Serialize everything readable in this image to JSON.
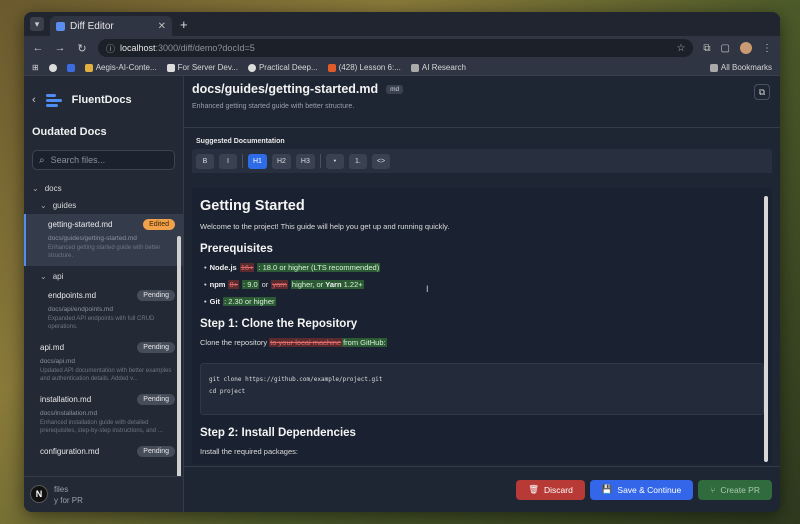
{
  "browser": {
    "tab_title": "Diff Editor",
    "url_host": "localhost",
    "url_path": ":3000/diff/demo?docId=5",
    "bookmarks": [
      "Aegis-AI-Conte...",
      "For Server Dev...",
      "Practical Deep...",
      "(428) Lesson 6:...",
      "AI Research"
    ],
    "all_bookmarks": "All Bookmarks"
  },
  "sidebar": {
    "brand": "FluentDocs",
    "title": "Oudated Docs",
    "search_placeholder": "Search files...",
    "folders": {
      "docs": "docs",
      "guides": "guides",
      "api": "api"
    },
    "items": [
      {
        "name": "getting-started.md",
        "badge": "Edited",
        "path": "docs/guides/getting-started.md",
        "desc": "Enhanced getting started guide with better structure."
      },
      {
        "name": "endpoints.md",
        "badge": "Pending",
        "path": "docs/api/endpoints.md",
        "desc": "Expanded API endpoints with full CRUD operations."
      },
      {
        "name": "api.md",
        "badge": "Pending",
        "path": "docs/api.md",
        "desc": "Updated API documentation with better examples and authentication details. Added v..."
      },
      {
        "name": "installation.md",
        "badge": "Pending",
        "path": "docs/installation.md",
        "desc": "Enhanced installation guide with detailed prerequisites, step-by-step instructions, and ..."
      },
      {
        "name": "configuration.md",
        "badge": "Pending"
      }
    ],
    "footer_line1": "files",
    "footer_line2": "y for PR",
    "n_badge": "N"
  },
  "doc": {
    "title": "docs/guides/getting-started.md",
    "tag": "md",
    "subtitle": "Enhanced getting started guide with better structure.",
    "suggested_label": "Suggested Documentation"
  },
  "toolbar": [
    "B",
    "I",
    "H1",
    "H2",
    "H3",
    "•",
    "1.",
    "<>"
  ],
  "content": {
    "h1": "Getting Started",
    "intro": "Welcome to the project! This guide will help you get up and running quickly.",
    "prereq_heading": "Prerequisites",
    "node_label": "Node.js",
    "node_del": "16+",
    "node_ins": ": 18.0 or higher (LTS recommended)",
    "npm_label": "npm",
    "npm_del": "8+",
    "npm_ins": ": 9.0",
    "npm_or": "or",
    "yarn_del": "yarn",
    "npm_mid": "higher, or",
    "yarn_label": "Yarn",
    "yarn_ins": "1.22+",
    "git_label": "Git",
    "git_ins": ": 2.30 or higher",
    "step1": "Step 1: Clone the Repository",
    "clone_text": "Clone the repository",
    "clone_del": "to your local machine",
    "clone_ins": "from GitHub:",
    "code1": "git clone https://github.com/example/project.git",
    "code2": "cd project",
    "step2": "Step 2: Install Dependencies",
    "install_text": "Install the required packages:"
  },
  "footer": {
    "discard": "Discard",
    "save": "Save & Continue",
    "create": "Create PR"
  },
  "colors": {
    "accent": "#3366e8",
    "discard": "#b83a36",
    "edited": "#f2a14b"
  }
}
